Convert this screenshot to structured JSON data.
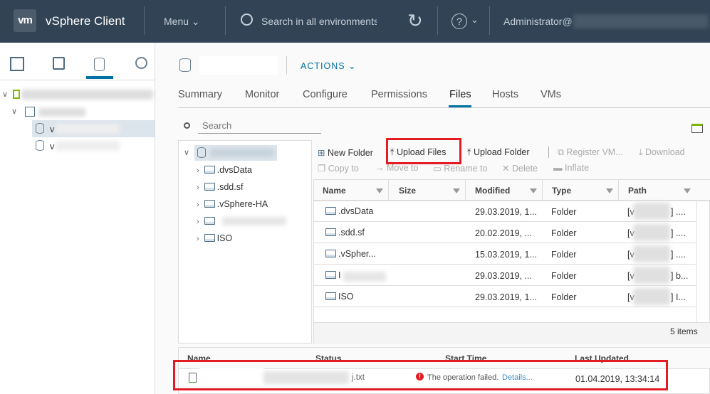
{
  "header": {
    "logo": "vm",
    "app_title": "vSphere Client",
    "menu_label": "Menu",
    "search_placeholder": "Search in all environments",
    "user": "Administrator@"
  },
  "sidebar": {
    "tabs": [
      "hosts-clusters",
      "vms-templates",
      "storage",
      "networking"
    ],
    "active_tab": 2,
    "tree": [
      {
        "label": ""
      },
      {
        "label": ""
      },
      {
        "label": "v",
        "selected": true
      },
      {
        "label": "v"
      }
    ]
  },
  "main": {
    "object_name": "",
    "actions_label": "ACTIONS",
    "tabs": [
      "Summary",
      "Monitor",
      "Configure",
      "Permissions",
      "Files",
      "Hosts",
      "VMs"
    ],
    "active_tab": "Files",
    "search_placeholder": "Search",
    "folder_tree": [
      ".dvsData",
      ".sdd.sf",
      ".vSphere-HA",
      "",
      "ISO"
    ],
    "toolbar": {
      "new_folder": "New Folder",
      "upload_files": "Upload Files",
      "upload_folder": "Upload Folder",
      "register_vm": "Register VM...",
      "download": "Download",
      "copy_to": "Copy to",
      "move_to": "Move to",
      "rename_to": "Rename to",
      "delete": "Delete",
      "inflate": "Inflate"
    },
    "columns": [
      "Name",
      "Size",
      "Modified",
      "Type",
      "Path"
    ],
    "rows": [
      {
        "name": ".dvsData",
        "size": "",
        "modified": "29.03.2019, 1...",
        "type": "Folder",
        "path": "[v",
        "path_end": "] ...."
      },
      {
        "name": ".sdd.sf",
        "size": "",
        "modified": "20.02.2019, ...",
        "type": "Folder",
        "path": "[v",
        "path_end": "] ...."
      },
      {
        "name": ".vSpher...",
        "size": "",
        "modified": "15.03.2019, 1...",
        "type": "Folder",
        "path": "[v",
        "path_end": "] ...."
      },
      {
        "name": "I",
        "size": "",
        "modified": "29.03.2019, ...",
        "type": "Folder",
        "path": "[v",
        "path_end": "] b..."
      },
      {
        "name": "ISO",
        "size": "",
        "modified": "29.03.2019, 1...",
        "type": "Folder",
        "path": "[v",
        "path_end": "] I..."
      }
    ],
    "item_count": "5 items"
  },
  "tasks": {
    "columns": [
      "Name",
      "Status",
      "Start Time",
      "Last Updated"
    ],
    "row": {
      "name_suffix": "j.txt",
      "status": "The operation failed.",
      "details_link": "Details...",
      "last_updated": "01.04.2019, 13:34:14"
    }
  },
  "colors": {
    "header_bg": "#314354",
    "accent": "#0072a3",
    "highlight": "#e31b23",
    "error": "#e31b23"
  }
}
